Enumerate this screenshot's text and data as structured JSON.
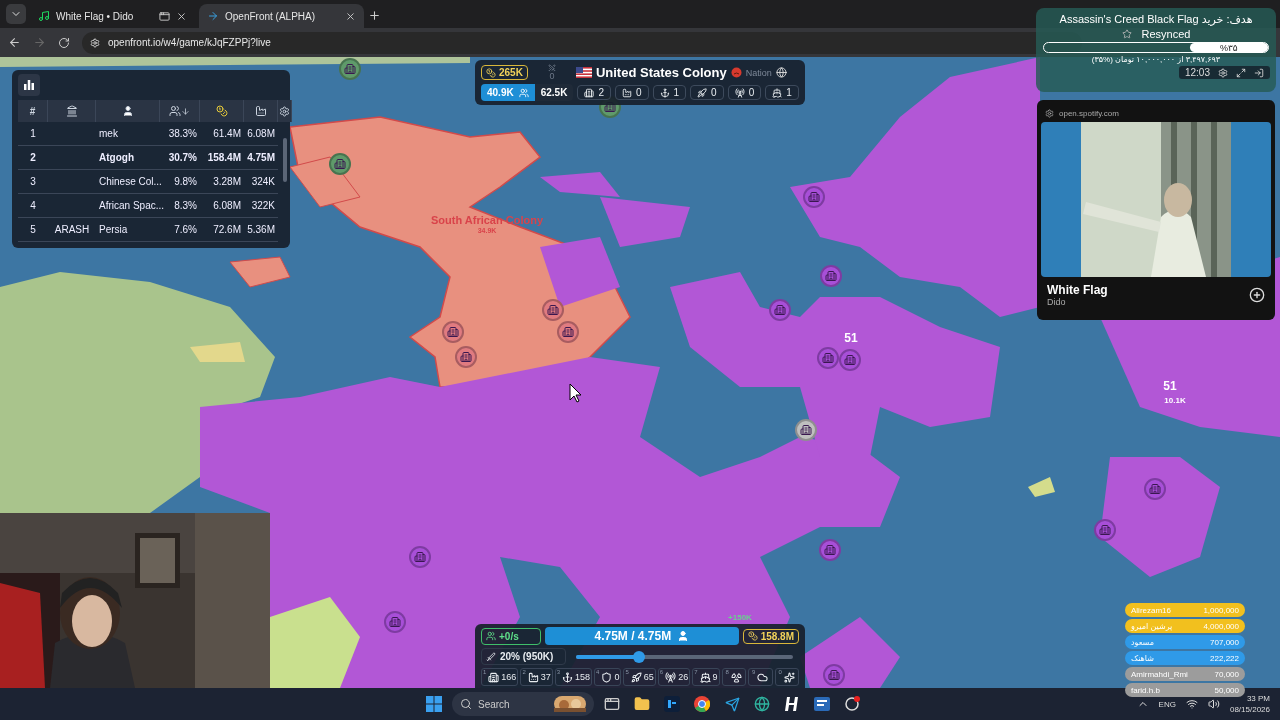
{
  "browser": {
    "tabs": [
      {
        "title": "White Flag • Dido",
        "kind": "music",
        "selected": false
      },
      {
        "title": "OpenFront (ALPHA)",
        "kind": "game",
        "selected": true
      }
    ],
    "url": "openfront.io/w4/game/kJqFZPPj?live"
  },
  "leaderboard": {
    "columns": [
      {
        "kind": "rank",
        "label": "#"
      },
      {
        "kind": "clan"
      },
      {
        "kind": "player"
      },
      {
        "kind": "tiles",
        "sorted": true
      },
      {
        "kind": "gold"
      },
      {
        "kind": "troops"
      }
    ],
    "rows": [
      {
        "rank": "1",
        "name": "mek",
        "tiles": "38.3%",
        "gold": "61.4M",
        "troops": "6.08M",
        "selected": false
      },
      {
        "rank": "2",
        "name": "Atgogh",
        "tiles": "30.7%",
        "gold": "158.4M",
        "troops": "4.75M",
        "selected": true
      },
      {
        "rank": "3",
        "name": "Chinese Col...",
        "tiles": "9.8%",
        "gold": "3.28M",
        "troops": "324K",
        "selected": false
      },
      {
        "rank": "4",
        "name": "African Spac...",
        "tiles": "8.3%",
        "gold": "6.08M",
        "troops": "322K",
        "selected": false
      },
      {
        "rank": "5",
        "clan": "ARASH",
        "name": "Persia",
        "tiles": "7.6%",
        "gold": "72.6M",
        "troops": "5.36M",
        "selected": false
      }
    ]
  },
  "player_info": {
    "gold": "265K",
    "attacks": "0",
    "name": "United States Colony",
    "relation": "Nation",
    "troops": "40.9K",
    "workers": "62.5K",
    "buildings": [
      {
        "kind": "city",
        "count": "2"
      },
      {
        "kind": "factory",
        "count": "0"
      },
      {
        "kind": "port",
        "count": "1"
      },
      {
        "kind": "missile",
        "count": "0"
      },
      {
        "kind": "sam",
        "count": "0"
      },
      {
        "kind": "warship",
        "count": "1"
      }
    ]
  },
  "map_labels": [
    {
      "text": "South African Colony",
      "kind": "name"
    },
    {
      "text": "34.9K",
      "kind": "name_sub"
    },
    {
      "text": "51",
      "kind": "count"
    },
    {
      "text": "51",
      "kind": "count"
    },
    {
      "text": "10.1K",
      "kind": "count_sub"
    },
    {
      "text": "+150K",
      "kind": "gain"
    }
  ],
  "control_panel": {
    "rate": "+0/s",
    "troop_bar": {
      "text": "4.75M / 4.75M",
      "level": 1
    },
    "gold": "158.8M",
    "attack_ratio": {
      "text": "20% (950K)",
      "level": 0.29
    },
    "build": [
      {
        "key": "1",
        "kind": "city",
        "count": "166"
      },
      {
        "key": "2",
        "kind": "factory",
        "count": "37"
      },
      {
        "key": "3",
        "kind": "port",
        "count": "158"
      },
      {
        "key": "4",
        "kind": "defense",
        "count": "0"
      },
      {
        "key": "5",
        "kind": "missile",
        "count": "65"
      },
      {
        "key": "6",
        "kind": "sam",
        "count": "26"
      },
      {
        "key": "7",
        "kind": "warship",
        "count": "9"
      },
      {
        "key": "8",
        "kind": "atom"
      },
      {
        "key": "9",
        "kind": "hydrogen"
      },
      {
        "key": "0",
        "kind": "mirv"
      }
    ]
  },
  "donation": {
    "goal": "هدف: خرید Assassin's Creed Black Flag",
    "status": "Resynced",
    "percent": "%۳۵",
    "level": 0.35,
    "amount": "۳,۴۹۷,۶۹۳ از ۱۰,۰۰۰,۰۰۰ تومان (%۳۵)",
    "time": "12:03"
  },
  "spotify": {
    "site": "open.spotify.com",
    "title": "White Flag",
    "artist": "Dido"
  },
  "donors": [
    {
      "name": "Alirezam16",
      "amount": "1,000,000",
      "color": "#f2c01e"
    },
    {
      "name": "پرشین امیرو",
      "amount": "4,000,000",
      "color": "#f2c01e"
    },
    {
      "name": "مسعود",
      "amount": "707,000",
      "color": "#2f9ae8"
    },
    {
      "name": "شاهنک",
      "amount": "222,222",
      "color": "#2f9ae8"
    },
    {
      "name": "Amirmahdi_Rmi",
      "amount": "70,000",
      "color": "#9c9c9c"
    },
    {
      "name": "farid.h.b",
      "amount": "50,000",
      "color": "#9c9c9c"
    }
  ],
  "taskbar": {
    "search": "Search",
    "language": "ENG",
    "time": "33 PM",
    "date": "08/15/2026"
  }
}
